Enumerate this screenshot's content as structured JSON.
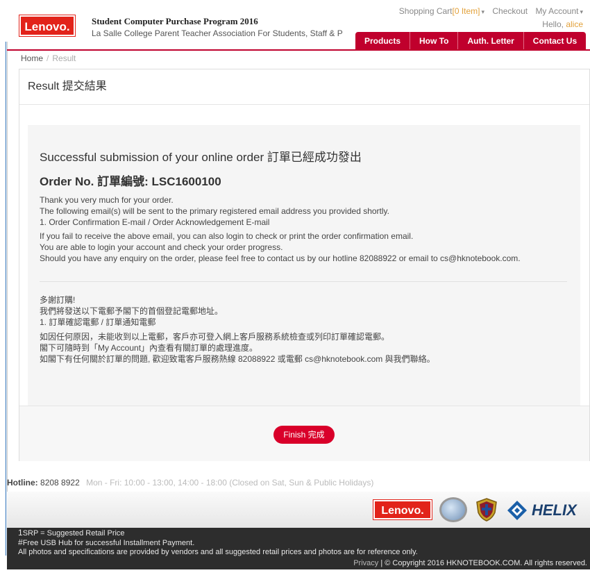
{
  "header": {
    "logo_text": "Lenovo.",
    "program_title": "Student Computer Purchase Program 2016",
    "program_sub": "La Salle College Parent Teacher Association  For Students, Staff & P",
    "shopping_cart": "Shopping Cart",
    "cart_count": "[0 Item]",
    "checkout": "Checkout",
    "my_account": "My Account",
    "hello": "Hello,",
    "user": "alice",
    "nav": [
      "Products",
      "How To",
      "Auth. Letter",
      "Contact Us"
    ]
  },
  "breadcrumb": {
    "home": "Home",
    "sep": "/",
    "current": "Result"
  },
  "panel": {
    "title": "Result 提交結果",
    "success_msg": "Successful submission of your online order 訂單已經成功發出",
    "order_label": "Order No. 訂單編號: LSC1600100",
    "en_lines": [
      "Thank you very much for your order.",
      "The following email(s) will be sent to the primary registered email address you provided shortly.",
      "1. Order Confirmation E-mail / Order Acknowledgement E-mail",
      "If you fail to receive the above email, you can also login to check or print the order confirmation email.",
      "You are able to login your account and check your order progress.",
      "Should you have any enquiry on the order, please feel free to contact us by our hotline 82088922 or email to cs@hknotebook.com."
    ],
    "zh_lines": [
      "多謝訂購!",
      "我們將發送以下電郵予閣下的首個登記電郵地址。",
      "1. 訂單確認電郵 / 訂單通知電郵",
      "如因任何原因，未能收到以上電郵，客戶亦可登入網上客戶服務系統檢查或列印訂單確認電郵。",
      "閣下可隨時到「My Account」內查看有關訂單的處理進度。",
      "如閣下有任何關於訂單的問題, 歡迎致電客戶服務熱線 82088922 或電郵 cs@hknotebook.com 與我們聯絡。"
    ],
    "finish_button": "Finish 完成"
  },
  "hotline": {
    "label": "Hotline:",
    "number": "8208 8922",
    "hours": "Mon - Fri: 10:00 - 13:00, 14:00 - 18:00 (Closed on Sat, Sun & Public Holidays)"
  },
  "footer_logos": {
    "lenovo": "Lenovo.",
    "helix": "HELIX"
  },
  "footer": {
    "srp_symbol": "1",
    "srp_text": "SRP = Suggested Retail Price",
    "usb_symbol": "#",
    "usb_text": "Free USB Hub for successful Installment Payment.",
    "disclaimer": "All photos and specifications are provided by vendors and all suggested retail prices and photos are for reference only.",
    "privacy": "Privacy",
    "copyright": " | © Copyright 2016 HKNOTEBOOK.COM. All rights reserved."
  },
  "colors": {
    "brand_red": "#c0002d",
    "lenovo_red": "#e2231a",
    "accent": "#e2a13a"
  }
}
